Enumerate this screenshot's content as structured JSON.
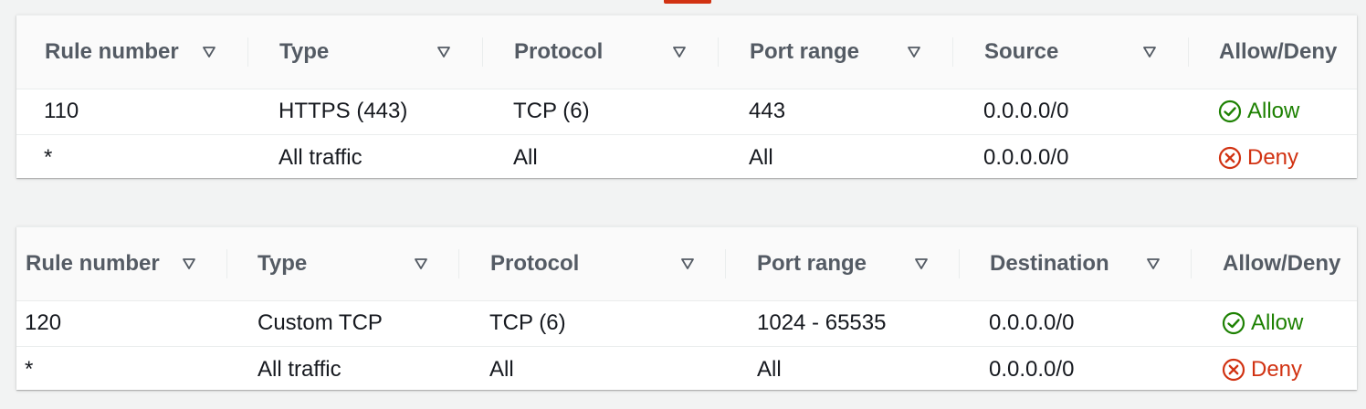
{
  "inbound": {
    "columns": [
      {
        "label": "Rule number",
        "icon": "sort-triangle-icon"
      },
      {
        "label": "Type",
        "icon": "sort-triangle-icon"
      },
      {
        "label": "Protocol",
        "icon": "sort-triangle-icon"
      },
      {
        "label": "Port range",
        "icon": "sort-triangle-icon"
      },
      {
        "label": "Source",
        "icon": "sort-triangle-icon"
      },
      {
        "label": "Allow/Deny"
      }
    ],
    "rows": [
      {
        "rule": "110",
        "type": "HTTPS (443)",
        "protocol": "TCP (6)",
        "port": "443",
        "target": "0.0.0.0/0",
        "action": "Allow",
        "action_icon": "check-circle-icon"
      },
      {
        "rule": "*",
        "type": "All traffic",
        "protocol": "All",
        "port": "All",
        "target": "0.0.0.0/0",
        "action": "Deny",
        "action_icon": "x-circle-icon"
      }
    ]
  },
  "outbound": {
    "columns": [
      {
        "label": "Rule number",
        "icon": "sort-triangle-icon"
      },
      {
        "label": "Type",
        "icon": "sort-triangle-icon"
      },
      {
        "label": "Protocol",
        "icon": "sort-triangle-icon"
      },
      {
        "label": "Port range",
        "icon": "sort-triangle-icon"
      },
      {
        "label": "Destination",
        "icon": "sort-triangle-icon"
      },
      {
        "label": "Allow/Deny"
      }
    ],
    "rows": [
      {
        "rule": "120",
        "type": "Custom TCP",
        "protocol": "TCP (6)",
        "port": "1024 - 65535",
        "target": "0.0.0.0/0",
        "action": "Allow",
        "action_icon": "check-circle-icon"
      },
      {
        "rule": "*",
        "type": "All traffic",
        "protocol": "All",
        "port": "All",
        "target": "0.0.0.0/0",
        "action": "Deny",
        "action_icon": "x-circle-icon"
      }
    ]
  },
  "colors": {
    "allow": "#1d8102",
    "deny": "#d13212",
    "header_text": "#545b64",
    "top_accent": "#d13212"
  }
}
